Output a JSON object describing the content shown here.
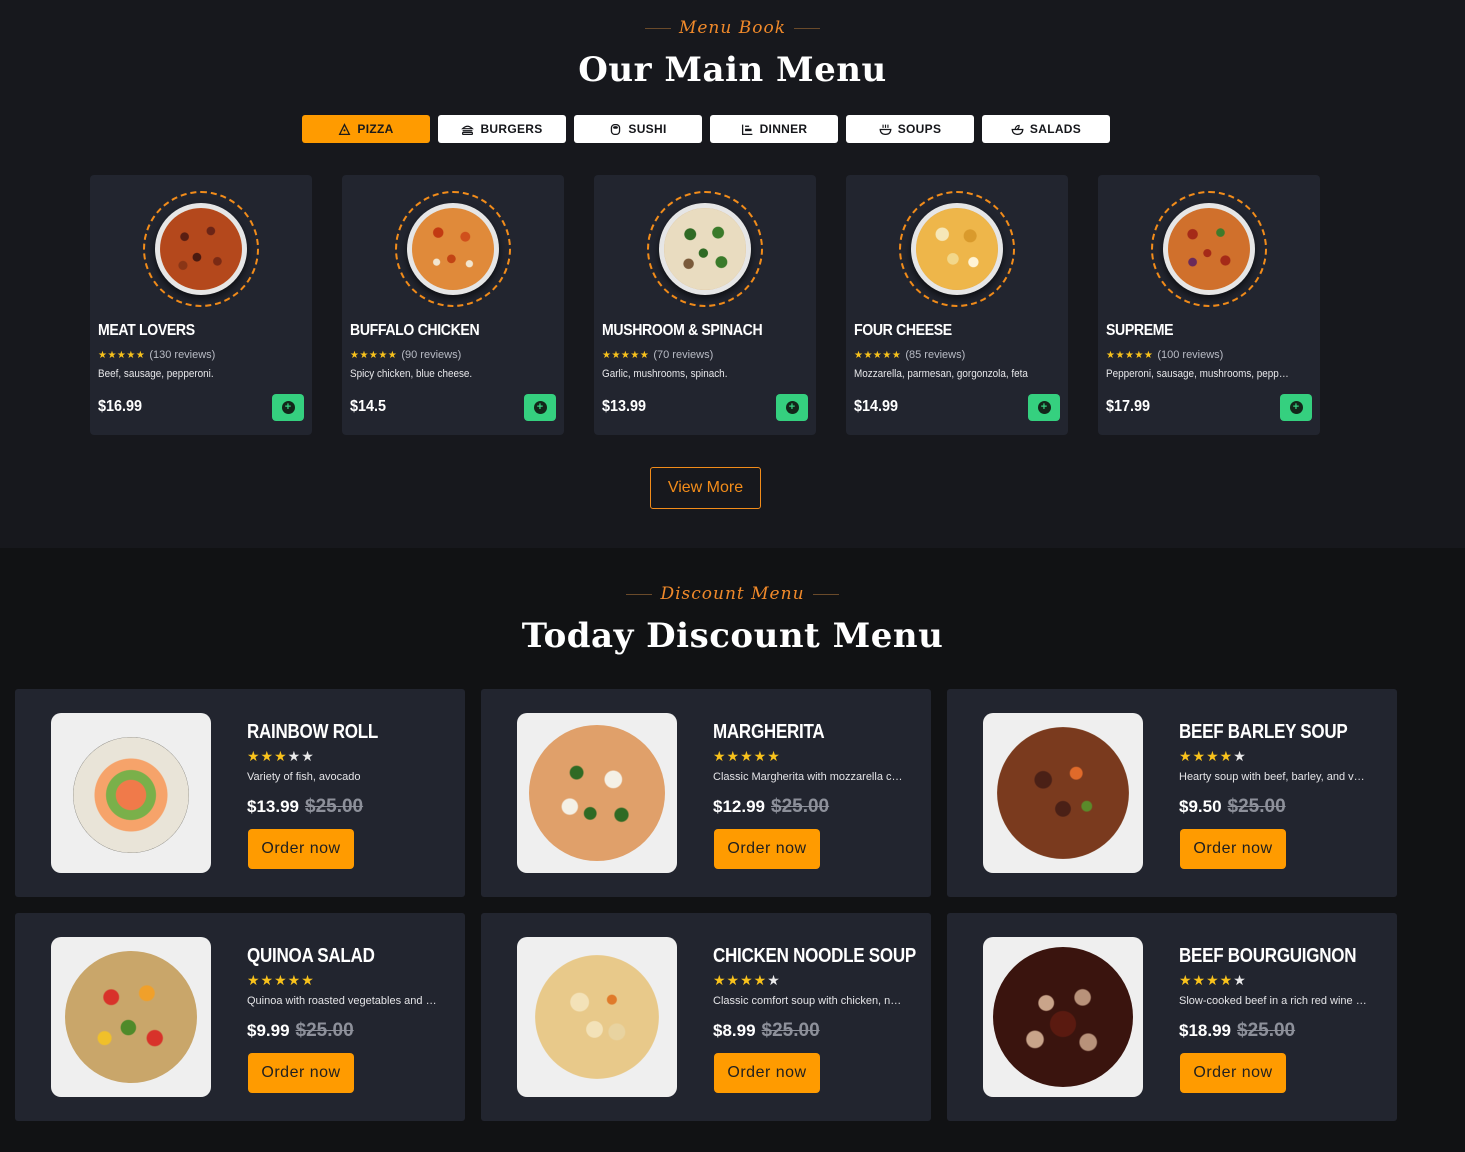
{
  "colors": {
    "accent": "#ff9b00",
    "accent_text": "#f28c1a",
    "add_button": "#35d07f",
    "star": "#f8c21c",
    "card_bg": "#22252f"
  },
  "main_menu": {
    "eyebrow": "Menu Book",
    "title": "Our Main Menu",
    "tabs": [
      {
        "label": "PIZZA",
        "icon": "pizza-icon",
        "active": true
      },
      {
        "label": "BURGERS",
        "icon": "burger-icon",
        "active": false
      },
      {
        "label": "SUSHI",
        "icon": "sushi-icon",
        "active": false
      },
      {
        "label": "DINNER",
        "icon": "dinner-icon",
        "active": false
      },
      {
        "label": "SOUPS",
        "icon": "soup-icon",
        "active": false
      },
      {
        "label": "SALADS",
        "icon": "salad-icon",
        "active": false
      }
    ],
    "items": [
      {
        "name": "MEAT LOVERS",
        "stars": "★★★★★",
        "reviews": "(130 reviews)",
        "desc": "Beef, sausage, pepperoni.",
        "price": "$16.99"
      },
      {
        "name": "BUFFALO CHICKEN",
        "stars": "★★★★★",
        "reviews": "(90 reviews)",
        "desc": "Spicy chicken, blue cheese.",
        "price": "$14.5"
      },
      {
        "name": "MUSHROOM & SPINACH",
        "stars": "★★★★★",
        "reviews": "(70 reviews)",
        "desc": "Garlic, mushrooms, spinach.",
        "price": "$13.99"
      },
      {
        "name": "FOUR CHEESE",
        "stars": "★★★★★",
        "reviews": "(85 reviews)",
        "desc": "Mozzarella, parmesan, gorgonzola, feta",
        "price": "$14.99"
      },
      {
        "name": "SUPREME",
        "stars": "★★★★★",
        "reviews": "(100 reviews)",
        "desc": "Pepperoni, sausage, mushrooms, peppers, ...",
        "price": "$17.99"
      }
    ],
    "view_more": "View More"
  },
  "discount_menu": {
    "eyebrow": "Discount Menu",
    "title": "Today Discount Menu",
    "order_label": "Order now",
    "items": [
      {
        "name": "RAINBOW ROLL",
        "stars_on": "★★★",
        "stars_off": "★★",
        "desc": "Variety of fish, avocado",
        "price": "$13.99",
        "old_price": "$25.00"
      },
      {
        "name": "MARGHERITA",
        "stars_on": "★★★★★",
        "stars_off": "",
        "desc": "Classic Margherita with mozzarella chees...",
        "price": "$12.99",
        "old_price": "$25.00"
      },
      {
        "name": "BEEF BARLEY SOUP",
        "stars_on": "★★★★",
        "stars_off": "★",
        "desc": "Hearty soup with beef, barley, and veget...",
        "price": "$9.50",
        "old_price": "$25.00"
      },
      {
        "name": "QUINOA SALAD",
        "stars_on": "★★★★★",
        "stars_off": "",
        "desc": "Quinoa with roasted vegetables and a lig...",
        "price": "$9.99",
        "old_price": "$25.00"
      },
      {
        "name": "CHICKEN NOODLE SOUP",
        "stars_on": "★★★★",
        "stars_off": "★",
        "desc": "Classic comfort soup with chicken, noodl...",
        "price": "$8.99",
        "old_price": "$25.00"
      },
      {
        "name": "BEEF BOURGUIGNON",
        "stars_on": "★★★★",
        "stars_off": "★",
        "desc": "Slow-cooked beef in a rich red wine sauc...",
        "price": "$18.99",
        "old_price": "$25.00"
      }
    ]
  }
}
